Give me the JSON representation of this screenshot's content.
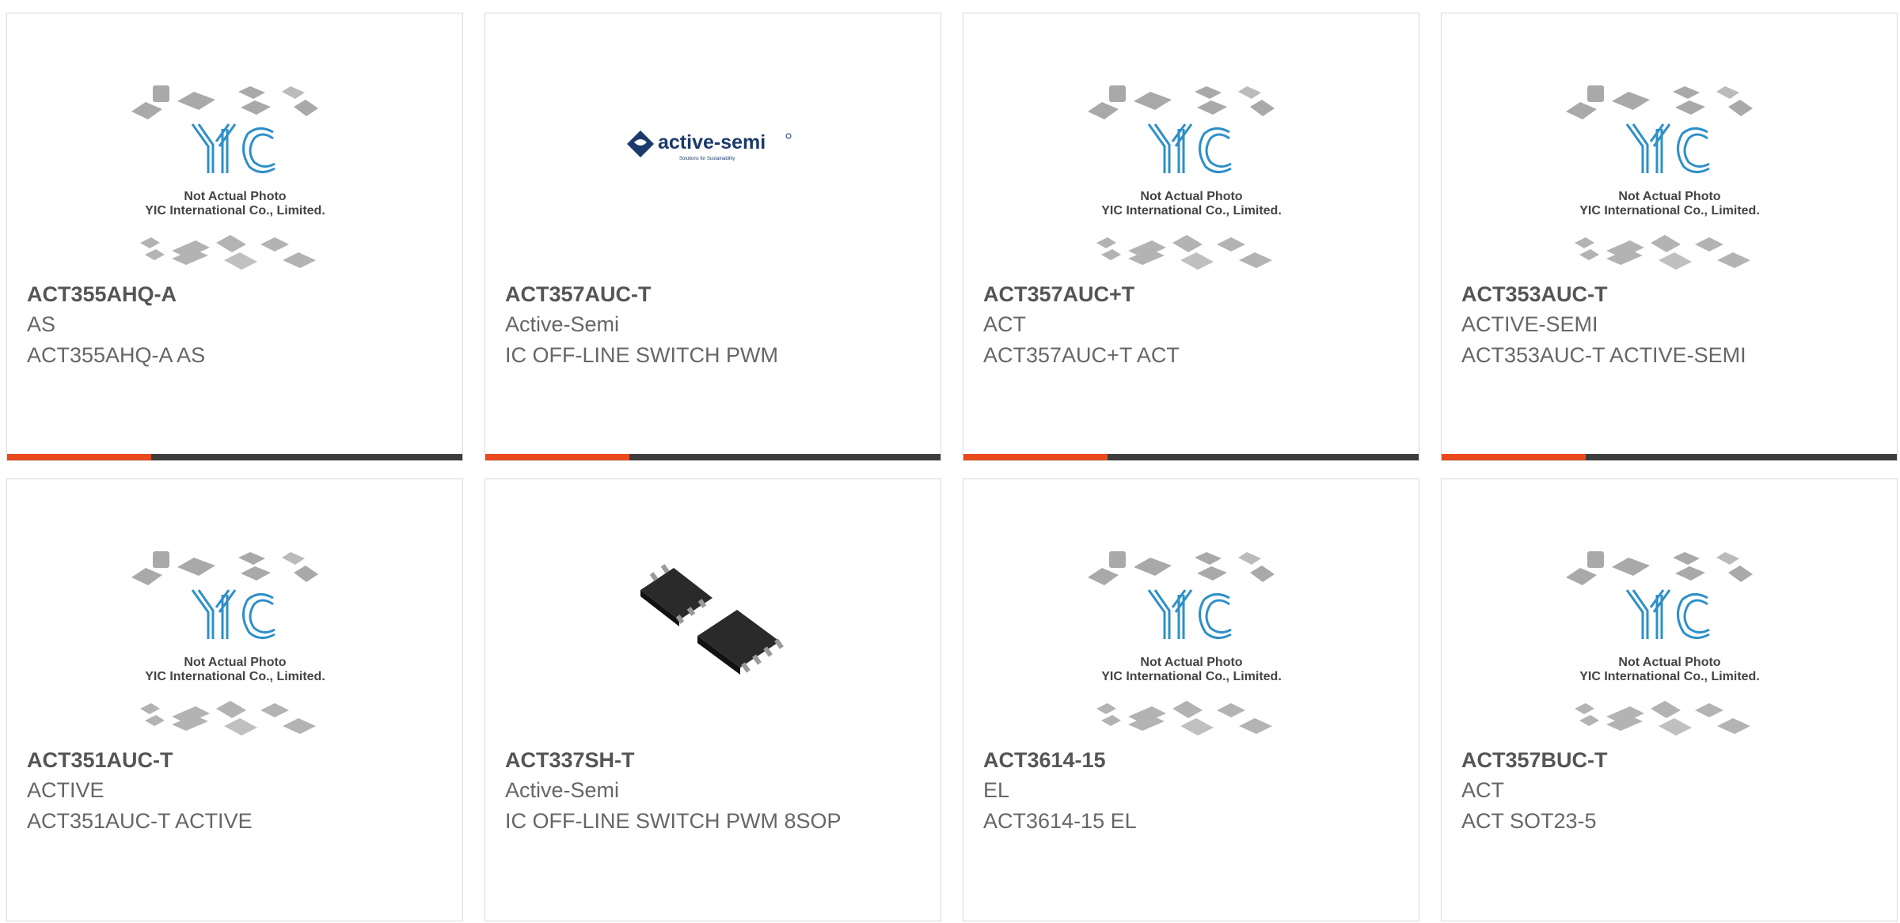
{
  "accent_color": "#e84a1c",
  "bar_color": "#3d3d3d",
  "placeholder": {
    "line1": "Not Actual Photo",
    "line2": "YIC International Co., Limited."
  },
  "logo": {
    "brand": "active-semi",
    "tagline": "Solutions for Sustainability"
  },
  "products": [
    {
      "part": "ACT355AHQ-A",
      "mfr": "AS",
      "desc": "ACT355AHQ-A AS",
      "image": "yic-placeholder"
    },
    {
      "part": "ACT357AUC-T",
      "mfr": "Active-Semi",
      "desc": "IC OFF-LINE SWITCH PWM",
      "image": "active-semi-logo"
    },
    {
      "part": "ACT357AUC+T",
      "mfr": "ACT",
      "desc": "ACT357AUC+T ACT",
      "image": "yic-placeholder"
    },
    {
      "part": "ACT353AUC-T",
      "mfr": "ACTIVE-SEMI",
      "desc": "ACT353AUC-T ACTIVE-SEMI",
      "image": "yic-placeholder"
    },
    {
      "part": "ACT351AUC-T",
      "mfr": "ACTIVE",
      "desc": "ACT351AUC-T ACTIVE",
      "image": "yic-placeholder"
    },
    {
      "part": "ACT337SH-T",
      "mfr": "Active-Semi",
      "desc": "IC OFF-LINE SWITCH PWM 8SOP",
      "image": "sop8-chip-photo"
    },
    {
      "part": "ACT3614-15",
      "mfr": "EL",
      "desc": "ACT3614-15 EL",
      "image": "yic-placeholder"
    },
    {
      "part": "ACT357BUC-T",
      "mfr": "ACT",
      "desc": "ACT SOT23-5",
      "image": "yic-placeholder"
    }
  ]
}
